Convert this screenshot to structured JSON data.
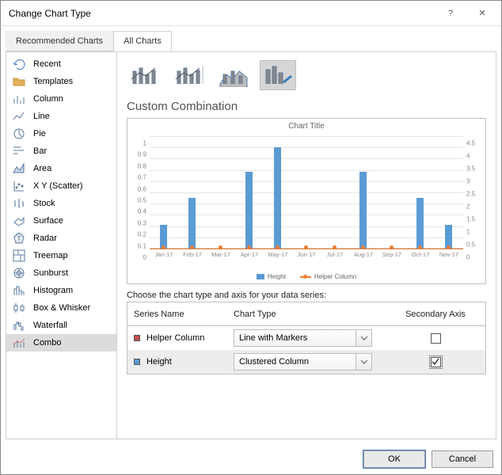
{
  "window": {
    "title": "Change Chart Type",
    "help_glyph": "?",
    "close_glyph": "✕"
  },
  "tabs": {
    "recommended": "Recommended Charts",
    "all": "All Charts"
  },
  "sidebar": {
    "items": [
      {
        "id": "recent",
        "label": "Recent"
      },
      {
        "id": "templates",
        "label": "Templates"
      },
      {
        "id": "column",
        "label": "Column"
      },
      {
        "id": "line",
        "label": "Line"
      },
      {
        "id": "pie",
        "label": "Pie"
      },
      {
        "id": "bar",
        "label": "Bar"
      },
      {
        "id": "area",
        "label": "Area"
      },
      {
        "id": "xy",
        "label": "X Y (Scatter)"
      },
      {
        "id": "stock",
        "label": "Stock"
      },
      {
        "id": "surface",
        "label": "Surface"
      },
      {
        "id": "radar",
        "label": "Radar"
      },
      {
        "id": "treemap",
        "label": "Treemap"
      },
      {
        "id": "sunburst",
        "label": "Sunburst"
      },
      {
        "id": "histogram",
        "label": "Histogram"
      },
      {
        "id": "boxwhisker",
        "label": "Box & Whisker"
      },
      {
        "id": "waterfall",
        "label": "Waterfall"
      },
      {
        "id": "combo",
        "label": "Combo"
      }
    ],
    "selected": "combo"
  },
  "main": {
    "section_title": "Custom Combination",
    "choose_text": "Choose the chart type and axis for your data series:"
  },
  "series_table": {
    "headers": {
      "name": "Series Name",
      "type": "Chart Type",
      "secondary": "Secondary Axis"
    },
    "rows": [
      {
        "name": "Helper Column",
        "color": "#c24d4d",
        "type": "Line with Markers",
        "secondary": false,
        "highlight": false
      },
      {
        "name": "Height",
        "color": "#5b9bd5",
        "type": "Clustered Column",
        "secondary": true,
        "highlight": true,
        "sec_focus": true
      }
    ]
  },
  "footer": {
    "ok": "OK",
    "cancel": "Cancel"
  },
  "chart_data": {
    "type": "bar",
    "title": "Chart Title",
    "categories": [
      "Jan-17",
      "Feb-17",
      "Mar-17",
      "Apr-17",
      "May-17",
      "Jun-17",
      "Jul-17",
      "Aug-17",
      "Sep-17",
      "Oct-17",
      "Nov-17"
    ],
    "series": [
      {
        "name": "Height",
        "type": "column",
        "axis": "primary",
        "color": "#5b9bd5",
        "values": [
          0.21,
          0.45,
          0.0,
          0.68,
          0.9,
          0.0,
          0.0,
          0.68,
          0.0,
          0.45,
          0.21
        ]
      },
      {
        "name": "Helper Column",
        "type": "line_marker",
        "axis": "secondary",
        "color": "#ed7d31",
        "values": [
          0,
          0,
          0,
          0,
          0,
          0,
          0,
          0,
          0,
          0,
          0
        ]
      }
    ],
    "ylabel": "",
    "xlabel": "",
    "ylim": [
      0,
      1
    ],
    "yticks": [
      0,
      0.1,
      0.2,
      0.3,
      0.4,
      0.5,
      0.6,
      0.7,
      0.8,
      0.9,
      1
    ],
    "y2lim": [
      0,
      4.5
    ],
    "y2ticks": [
      0,
      0.5,
      1,
      1.5,
      2,
      2.5,
      3,
      3.5,
      4,
      4.5
    ],
    "legend": {
      "position": "bottom",
      "items": [
        "Height",
        "Helper Column"
      ]
    }
  }
}
